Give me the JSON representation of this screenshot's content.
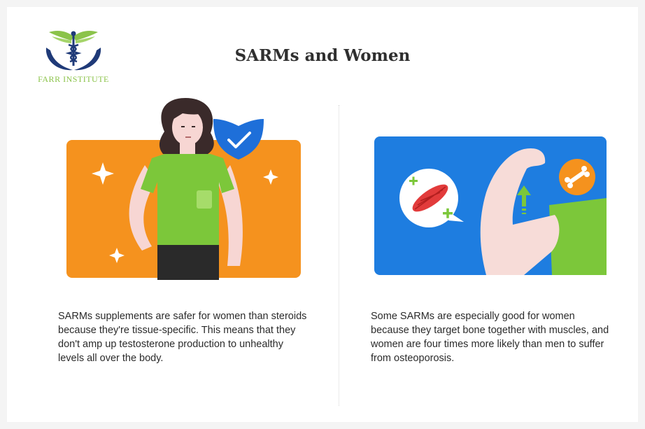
{
  "brand": {
    "name": "Farr Institute",
    "logo_text": "FARR INSTITUTE",
    "color": "#8bc34a"
  },
  "title": "SARMs and Women",
  "colors": {
    "orange_panel": "#f5921e",
    "blue_panel": "#1e7de0",
    "shirt_green": "#7cc73a",
    "shield_blue": "#1e6fd9",
    "logo_navy": "#1f3a78"
  },
  "panels": [
    {
      "illustration": "woman-with-shield",
      "icons": [
        "sparkle-icon",
        "check-shield-icon"
      ],
      "text": "SARMs supplements are safer for women than steroids because they're tissue-specific. This means that they don't amp up testosterone production to unhealthy levels all over the body."
    },
    {
      "illustration": "flexed-arm-with-muscle-and-bone",
      "icons": [
        "muscle-icon",
        "bone-icon",
        "arrow-up-icon",
        "plus-icon"
      ],
      "text": "Some SARMs are especially good for women because they target bone together with muscles, and women are four times more likely than men to suffer from osteoporosis."
    }
  ]
}
